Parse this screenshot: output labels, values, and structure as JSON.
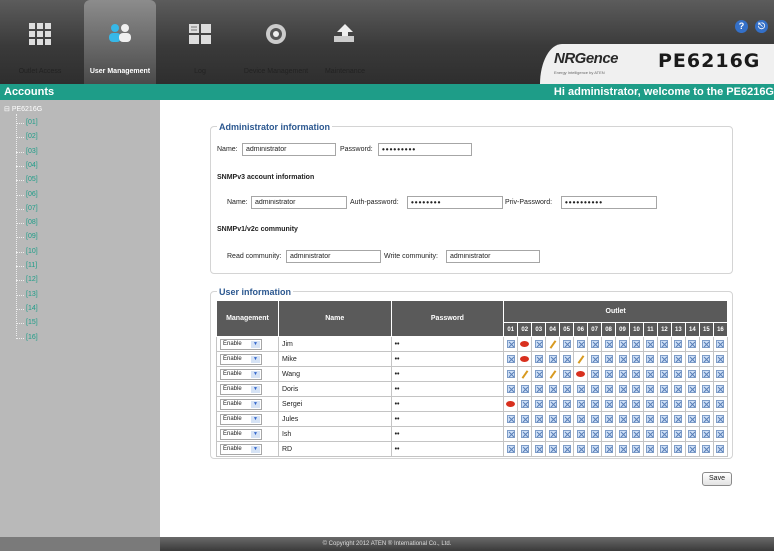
{
  "nav": [
    {
      "label": "Outlet Access",
      "icon": "outlet-grid-icon"
    },
    {
      "label": "User Management",
      "icon": "users-icon",
      "active": true
    },
    {
      "label": "Log",
      "icon": "log-icon"
    },
    {
      "label": "Device Management",
      "icon": "device-gear-icon"
    },
    {
      "label": "Maintenance",
      "icon": "maintenance-icon"
    }
  ],
  "brand": {
    "logo": "NRGence",
    "subtitle": "Energy Intelligence by ATEN",
    "model": "PE6216G"
  },
  "header": {
    "help_icon": "?",
    "logout_icon": "⎋"
  },
  "tealbar": {
    "left": "Accounts",
    "right": "Hi administrator, welcome to the PE6216G"
  },
  "sidebar": {
    "root": "PE6216G",
    "items": [
      "[01]",
      "[02]",
      "[03]",
      "[04]",
      "[05]",
      "[06]",
      "[07]",
      "[08]",
      "[09]",
      "[10]",
      "[11]",
      "[12]",
      "[13]",
      "[14]",
      "[15]",
      "[16]"
    ]
  },
  "admin": {
    "title": "Administrator information",
    "name_label": "Name:",
    "name_value": "administrator",
    "password_label": "Password:",
    "password_value": "•••••••••",
    "snmpv3_title": "SNMPv3 account information",
    "v3_name_label": "Name:",
    "v3_name_value": "administrator",
    "auth_label": "Auth-password:",
    "auth_value": "••••••••",
    "priv_label": "Priv-Password:",
    "priv_value": "••••••••••",
    "snmpv1_title": "SNMPv1/v2c community",
    "read_label": "Read community:",
    "read_value": "administrator",
    "write_label": "Write community:",
    "write_value": "administrator"
  },
  "users": {
    "title": "User information",
    "col_management": "Management",
    "col_name": "Name",
    "col_password": "Password",
    "col_outlet": "Outlet",
    "outlets": [
      "01",
      "02",
      "03",
      "04",
      "05",
      "06",
      "07",
      "08",
      "09",
      "10",
      "11",
      "12",
      "13",
      "14",
      "15",
      "16"
    ],
    "rows": [
      {
        "mgmt": "Enable",
        "name": "Jim",
        "password": "••",
        "outlets": [
          "x",
          "view",
          "x",
          "edit",
          "x",
          "x",
          "x",
          "x",
          "x",
          "x",
          "x",
          "x",
          "x",
          "x",
          "x",
          "x"
        ]
      },
      {
        "mgmt": "Enable",
        "name": "Mike",
        "password": "••",
        "outlets": [
          "x",
          "view",
          "x",
          "x",
          "x",
          "edit",
          "x",
          "x",
          "x",
          "x",
          "x",
          "x",
          "x",
          "x",
          "x",
          "x"
        ]
      },
      {
        "mgmt": "Enable",
        "name": "Wang",
        "password": "••",
        "outlets": [
          "x",
          "edit",
          "x",
          "edit",
          "x",
          "view",
          "x",
          "x",
          "x",
          "x",
          "x",
          "x",
          "x",
          "x",
          "x",
          "x"
        ]
      },
      {
        "mgmt": "Enable",
        "name": "Doris",
        "password": "••",
        "outlets": [
          "x",
          "x",
          "x",
          "x",
          "x",
          "x",
          "x",
          "x",
          "x",
          "x",
          "x",
          "x",
          "x",
          "x",
          "x",
          "x"
        ]
      },
      {
        "mgmt": "Enable",
        "name": "Sergei",
        "password": "••",
        "outlets": [
          "view",
          "x",
          "x",
          "x",
          "x",
          "x",
          "x",
          "x",
          "x",
          "x",
          "x",
          "x",
          "x",
          "x",
          "x",
          "x"
        ]
      },
      {
        "mgmt": "Enable",
        "name": "Jules",
        "password": "••",
        "outlets": [
          "x",
          "x",
          "x",
          "x",
          "x",
          "x",
          "x",
          "x",
          "x",
          "x",
          "x",
          "x",
          "x",
          "x",
          "x",
          "x"
        ]
      },
      {
        "mgmt": "Enable",
        "name": "Ish",
        "password": "••",
        "outlets": [
          "x",
          "x",
          "x",
          "x",
          "x",
          "x",
          "x",
          "x",
          "x",
          "x",
          "x",
          "x",
          "x",
          "x",
          "x",
          "x"
        ]
      },
      {
        "mgmt": "Enable",
        "name": "RD",
        "password": "••",
        "outlets": [
          "x",
          "x",
          "x",
          "x",
          "x",
          "x",
          "x",
          "x",
          "x",
          "x",
          "x",
          "x",
          "x",
          "x",
          "x",
          "x"
        ]
      }
    ]
  },
  "save_label": "Save",
  "footer": "© Copyright 2012 ATEN ® International Co., Ltd."
}
